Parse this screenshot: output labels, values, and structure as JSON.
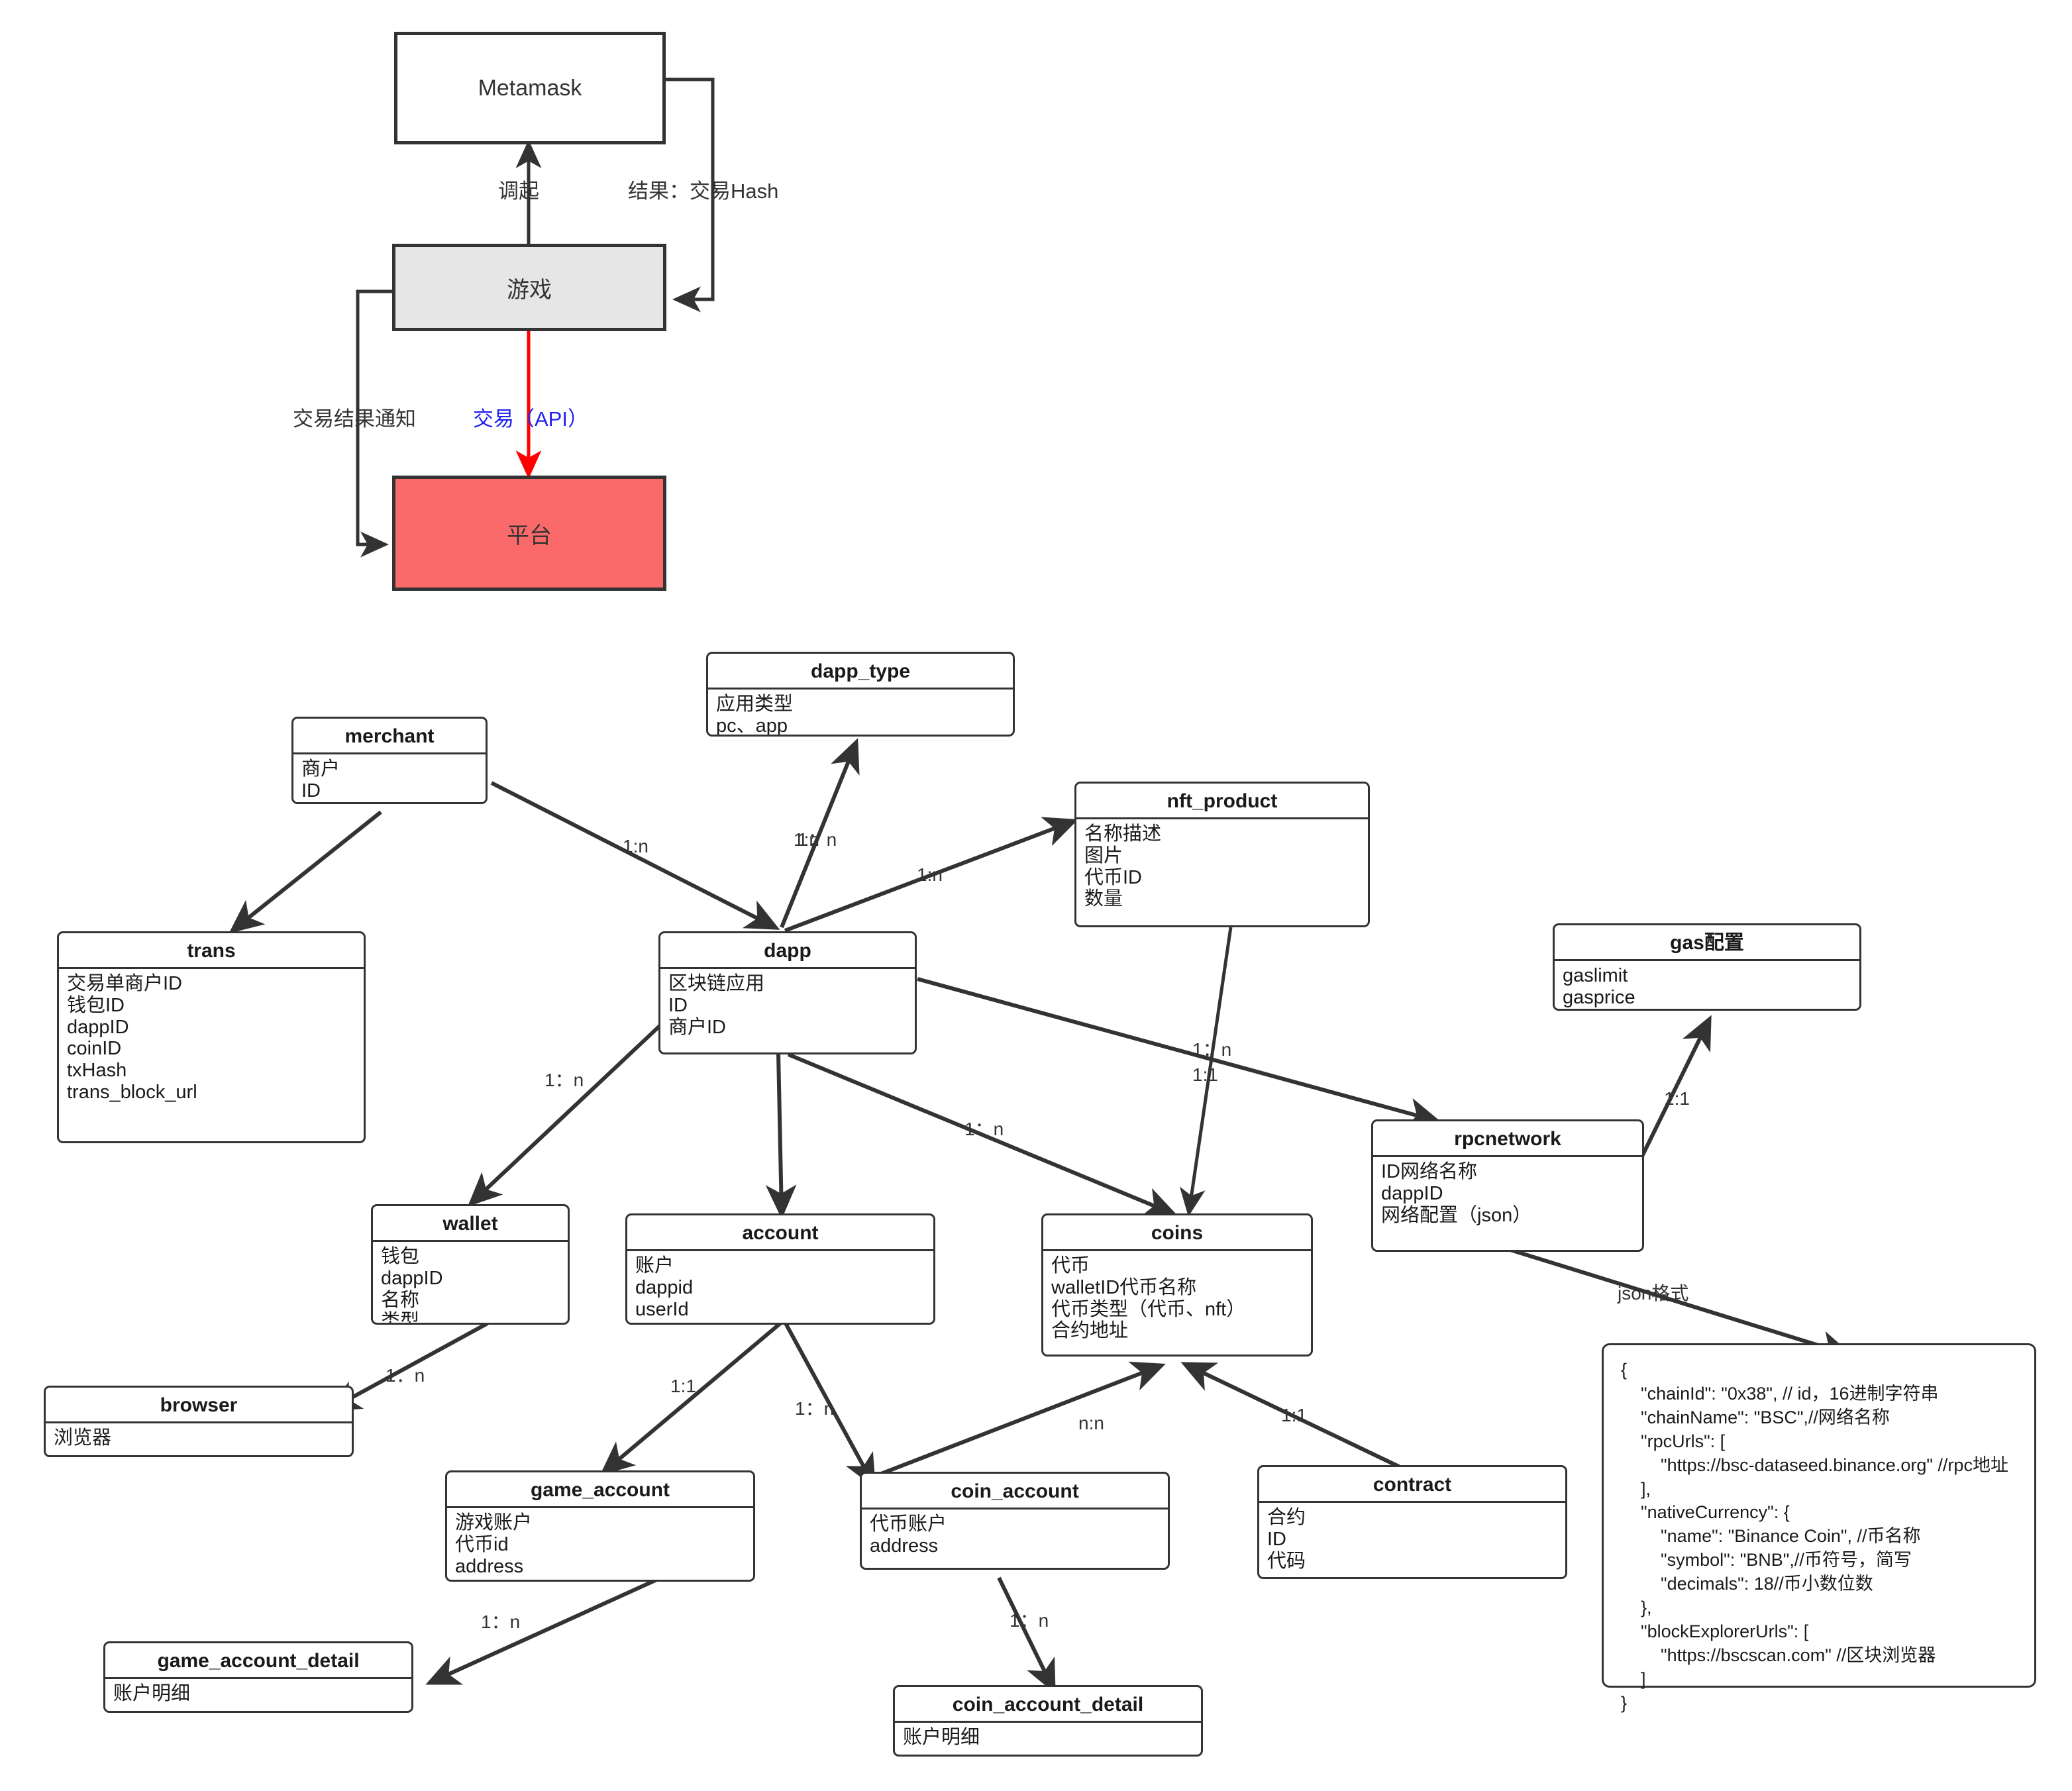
{
  "flow": {
    "boxes": [
      {
        "id": "metamask",
        "label": "Metamask",
        "style": "white"
      },
      {
        "id": "game",
        "label": "游戏",
        "style": "gray"
      },
      {
        "id": "platform",
        "label": "平台",
        "style": "red"
      }
    ],
    "edges": [
      {
        "id": "invoke",
        "label": "调起",
        "from": "game",
        "to": "metamask",
        "color": "#333333"
      },
      {
        "id": "result",
        "label": "结果：交易Hash",
        "from": "metamask",
        "to": "game",
        "color": "#333333"
      },
      {
        "id": "notify",
        "label": "交易结果通知",
        "from": "game",
        "to": "platform",
        "color": "#333333"
      },
      {
        "id": "trade",
        "label": "交易（API）",
        "from": "game",
        "to": "platform",
        "color": "#ff0000"
      }
    ],
    "colors": {
      "gray_fill": "#e6e6e6",
      "red_fill": "#fa6a6a",
      "stroke": "#333333",
      "trade_line": "#ff0000",
      "trade_label": "#2020ee"
    }
  },
  "er": {
    "entities": [
      {
        "id": "dapp_type",
        "name": "dapp_type",
        "attrs": [
          "应用类型",
          "pc、app"
        ]
      },
      {
        "id": "merchant",
        "name": "merchant",
        "attrs": [
          "商户",
          "ID"
        ]
      },
      {
        "id": "nft_product",
        "name": "nft_product",
        "attrs": [
          "名称描述",
          "图片",
          "代币ID",
          "数量"
        ]
      },
      {
        "id": "trans",
        "name": "trans",
        "attrs": [
          "交易单商户ID",
          "钱包ID",
          "dappID",
          "coinID",
          "txHash",
          "trans_block_url"
        ]
      },
      {
        "id": "dapp",
        "name": "dapp",
        "attrs": [
          "区块链应用",
          "ID",
          "商户ID"
        ]
      },
      {
        "id": "gas",
        "name": "gas配置",
        "attrs": [
          "gaslimit",
          "gasprice"
        ]
      },
      {
        "id": "rpcnetwork",
        "name": "rpcnetwork",
        "attrs": [
          "ID网络名称",
          "dappID",
          "网络配置（json）"
        ]
      },
      {
        "id": "wallet",
        "name": "wallet",
        "attrs": [
          "钱包",
          "dappID",
          "名称",
          "类型"
        ]
      },
      {
        "id": "account",
        "name": "account",
        "attrs": [
          "账户",
          "dappid",
          "userId"
        ]
      },
      {
        "id": "coins",
        "name": "coins",
        "attrs": [
          "代币",
          "walletID代币名称",
          "代币类型（代币、nft）",
          "合约地址"
        ]
      },
      {
        "id": "browser",
        "name": "browser",
        "attrs": [
          "浏览器"
        ]
      },
      {
        "id": "game_account",
        "name": "game_account",
        "attrs": [
          "游戏账户",
          "代币id",
          "address"
        ]
      },
      {
        "id": "coin_account",
        "name": "coin_account",
        "attrs": [
          "代币账户",
          "address"
        ]
      },
      {
        "id": "contract",
        "name": "contract",
        "attrs": [
          "合约",
          "ID",
          "代码"
        ]
      },
      {
        "id": "game_account_detail",
        "name": "game_account_detail",
        "attrs": [
          "账户明细"
        ]
      },
      {
        "id": "coin_account_detail",
        "name": "coin_account_detail",
        "attrs": [
          "账户明细"
        ]
      }
    ],
    "relationships": [
      {
        "from": "merchant",
        "to": "trans",
        "label": "1:n"
      },
      {
        "from": "merchant",
        "to": "dapp",
        "label": "1:n"
      },
      {
        "from": "dapp",
        "to": "dapp_type",
        "label": "1：n"
      },
      {
        "from": "dapp",
        "to": "nft_product",
        "label": "1:n"
      },
      {
        "from": "dapp",
        "to": "wallet",
        "label": "1：n"
      },
      {
        "from": "dapp",
        "to": "account",
        "label": ""
      },
      {
        "from": "dapp",
        "to": "coins",
        "label": "1：n"
      },
      {
        "from": "dapp",
        "to": "rpcnetwork",
        "label": "1：n"
      },
      {
        "from": "nft_product",
        "to": "coins",
        "label": "1:1"
      },
      {
        "from": "rpcnetwork",
        "to": "gas",
        "label": "1:1"
      },
      {
        "from": "rpcnetwork",
        "to": "json_note",
        "label": "json格式"
      },
      {
        "from": "wallet",
        "to": "browser",
        "label": "1：n"
      },
      {
        "from": "account",
        "to": "game_account",
        "label": "1:1"
      },
      {
        "from": "account",
        "to": "coin_account",
        "label": "1：n"
      },
      {
        "from": "coin_account",
        "to": "coins",
        "label": "n:n"
      },
      {
        "from": "contract",
        "to": "coins",
        "label": "1:1"
      },
      {
        "from": "game_account",
        "to": "game_account_detail",
        "label": "1：n"
      },
      {
        "from": "coin_account",
        "to": "coin_account_detail",
        "label": "1：n"
      }
    ]
  },
  "json_note": {
    "lines": [
      "{",
      "    \"chainId\": \"0x38\", // id，16进制字符串",
      "    \"chainName\": \"BSC\",//网络名称",
      "    \"rpcUrls\": [",
      "        \"https://bsc-dataseed.binance.org\" //rpc地址",
      "    ],",
      "    \"nativeCurrency\": {",
      "        \"name\": \"Binance Coin\", //币名称",
      "        \"symbol\": \"BNB\",//币符号，简写",
      "        \"decimals\": 18//币小数位数",
      "    },",
      "    \"blockExplorerUrls\": [",
      "        \"https://bscscan.com\" //区块浏览器",
      "    ]",
      "}"
    ]
  }
}
